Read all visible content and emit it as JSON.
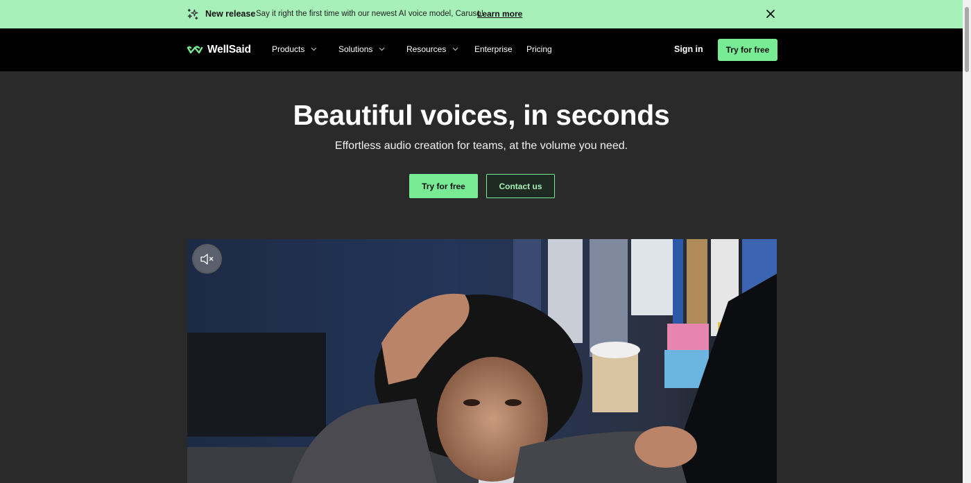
{
  "announcement": {
    "label": "New release",
    "message": "Say it right the first time with our newest AI voice model, Caruso!",
    "link": "Learn more",
    "icon": "sparkle-icon",
    "close_icon": "close-icon",
    "background": "#a7f0b9"
  },
  "nav": {
    "brand": "WellSaid",
    "items": [
      {
        "label": "Products",
        "has_dropdown": true
      },
      {
        "label": "Solutions",
        "has_dropdown": true
      },
      {
        "label": "Resources",
        "has_dropdown": true
      },
      {
        "label": "Enterprise",
        "has_dropdown": false
      },
      {
        "label": "Pricing",
        "has_dropdown": false
      }
    ],
    "sign_in": "Sign in",
    "cta": "Try for free",
    "accent": "#78ec95"
  },
  "hero": {
    "title": "Beautiful voices, in seconds",
    "subtitle": "Effortless audio creation for teams, at the volume you need.",
    "primary_button": "Try for free",
    "secondary_button": "Contact us"
  },
  "video": {
    "mute_icon": "speaker-muted-icon"
  }
}
